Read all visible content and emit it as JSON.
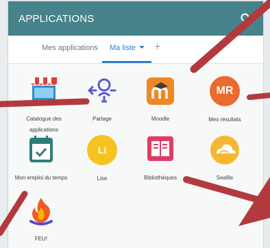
{
  "header": {
    "title": "APPLICATIONS",
    "search_icon": "search-icon"
  },
  "tabs": {
    "mes_applications": "Mes applications",
    "ma_liste": "Ma liste",
    "add": "+"
  },
  "apps": [
    {
      "label_line1": "Catalogue des",
      "label_line2": "applications",
      "icon": "storefront-icon"
    },
    {
      "label": "Partage",
      "icon": "share-person-icon"
    },
    {
      "label": "Moodle",
      "icon": "moodle-icon"
    },
    {
      "label": "Mes résultats",
      "icon": "mr-badge-icon",
      "badge": "MR"
    },
    {
      "label": "Mon emploi du temps",
      "icon": "calendar-icon"
    },
    {
      "label": "Lise",
      "icon": "li-badge-icon",
      "badge": "Li"
    },
    {
      "label": "Bibliothèques",
      "icon": "book-icon"
    },
    {
      "label": "Seafile",
      "icon": "seafile-icon"
    },
    {
      "label": "FEU!",
      "icon": "flame-icon"
    }
  ],
  "colors": {
    "header": "#46838a",
    "accent": "#2f7ec7",
    "annotation_arrow": "#b23a3e"
  }
}
